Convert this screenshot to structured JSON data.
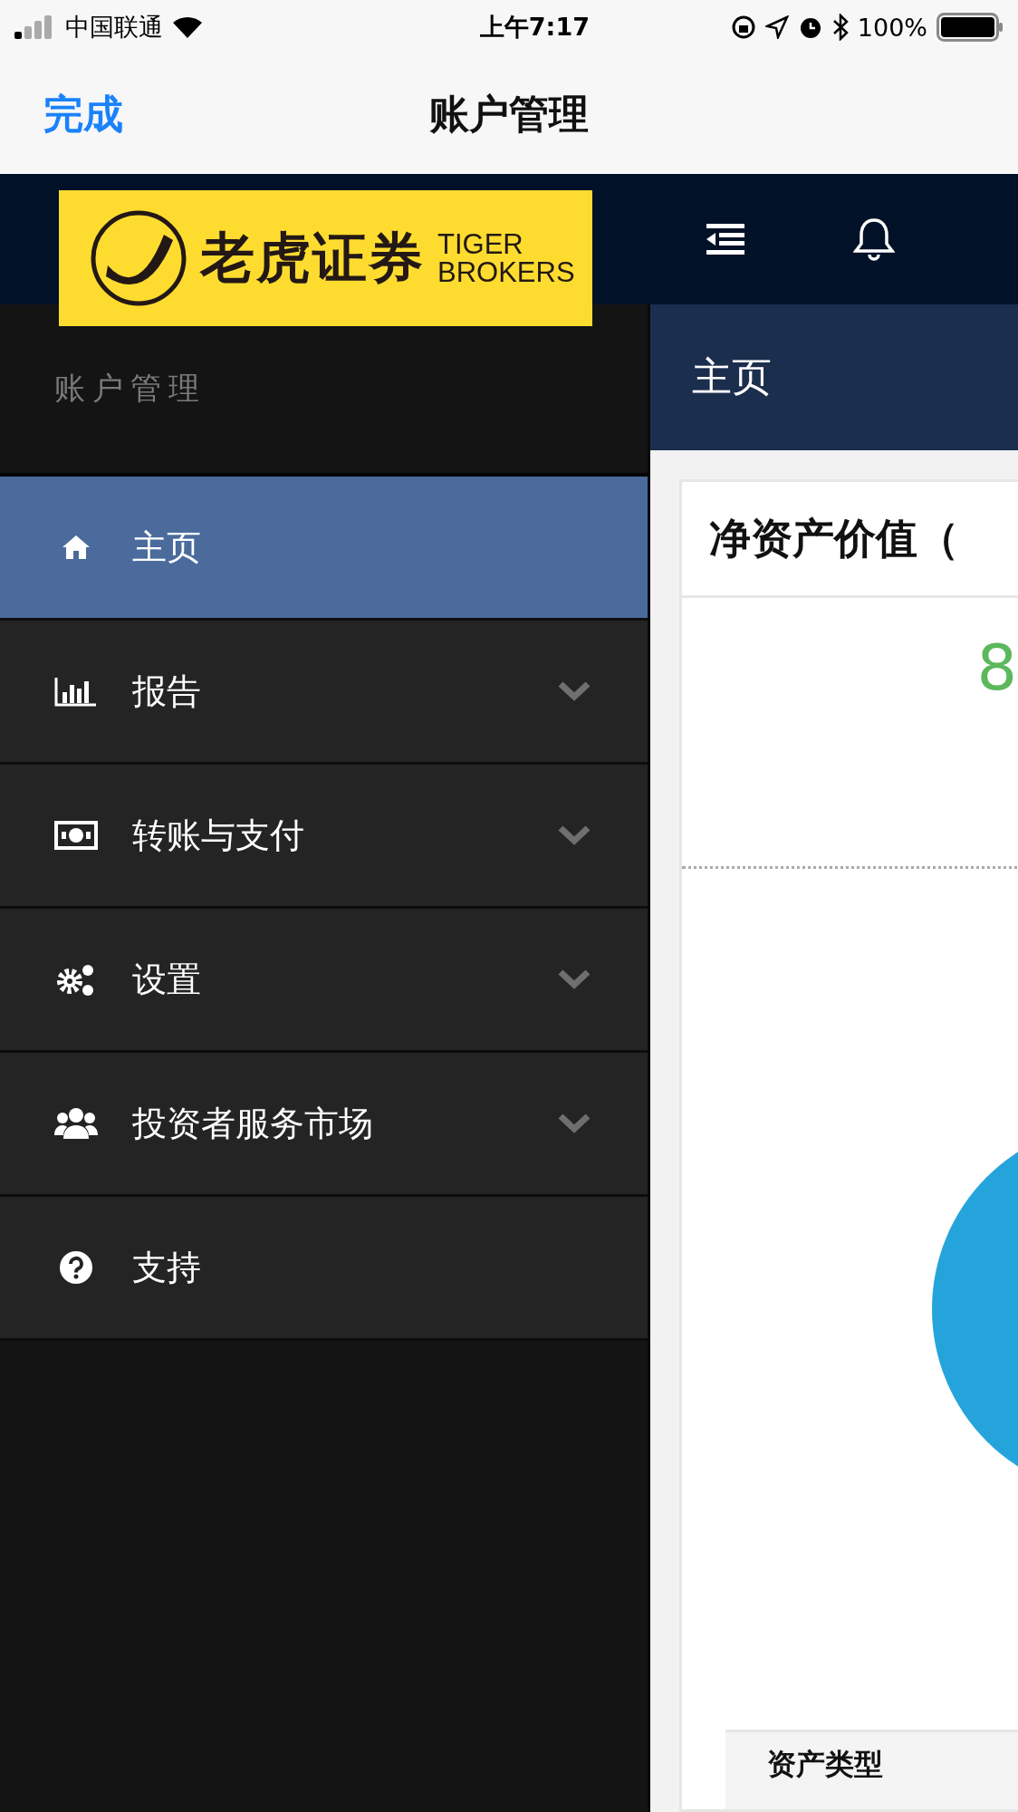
{
  "status_bar": {
    "carrier": "中国联通",
    "time": "上午7:17",
    "battery": "100%"
  },
  "logo": {
    "chinese": "老虎证券",
    "english": [
      "TIGER",
      "BROKERS"
    ]
  },
  "nav_bar": {
    "done": "完成",
    "title": "账户管理"
  },
  "sidebar": {
    "title": "账户管理",
    "items": [
      {
        "label": "主页",
        "selected": true,
        "kind": "link"
      },
      {
        "label": "报告",
        "selected": false,
        "kind": "submenu"
      },
      {
        "label": "转账与支付",
        "selected": false,
        "kind": "submenu"
      },
      {
        "label": "设置",
        "selected": false,
        "kind": "submenu"
      },
      {
        "label": "投资者服务市场",
        "selected": false,
        "kind": "submenu"
      },
      {
        "label": "支持",
        "selected": false,
        "kind": "link"
      }
    ]
  },
  "main": {
    "heading": "主页",
    "card": {
      "title": "净资产价值（",
      "value": "8",
      "table_header": "资产类型"
    }
  }
}
